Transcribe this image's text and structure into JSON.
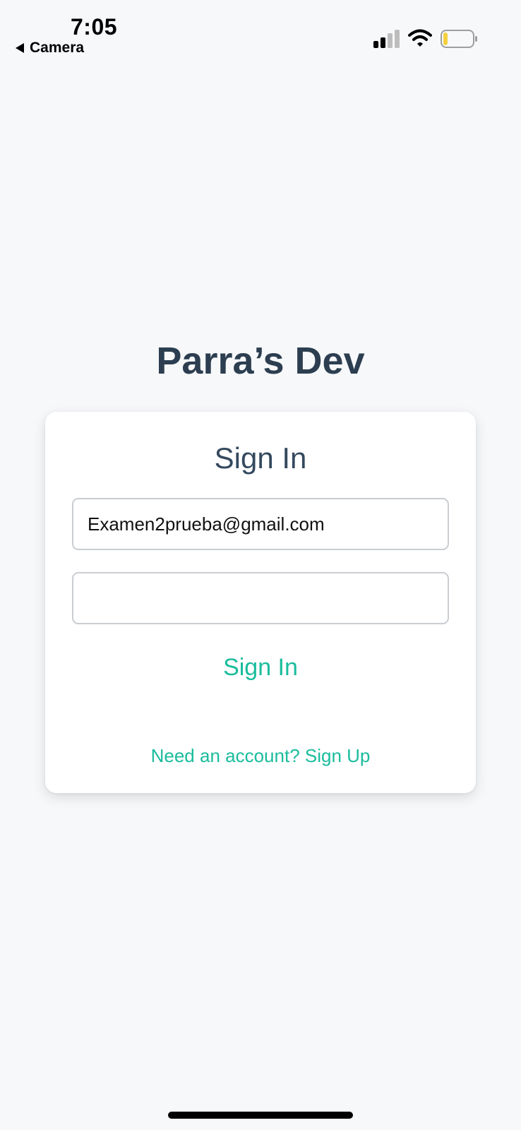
{
  "status_bar": {
    "time": "7:05",
    "back_label": "Camera",
    "signal_icon": "cellular-signal-icon",
    "wifi_icon": "wifi-icon",
    "battery_icon": "battery-icon",
    "battery_level_color": "#f4d03f"
  },
  "app": {
    "title": "Parra’s Dev"
  },
  "sign_in_card": {
    "title": "Sign In",
    "email_value": "Examen2prueba@gmail.com",
    "password_value": "",
    "submit_label": "Sign In",
    "signup_prompt": "Need an account? Sign Up"
  },
  "colors": {
    "accent": "#1abc9c",
    "title_text": "#2c3e50",
    "background": "#f7f8fa"
  }
}
